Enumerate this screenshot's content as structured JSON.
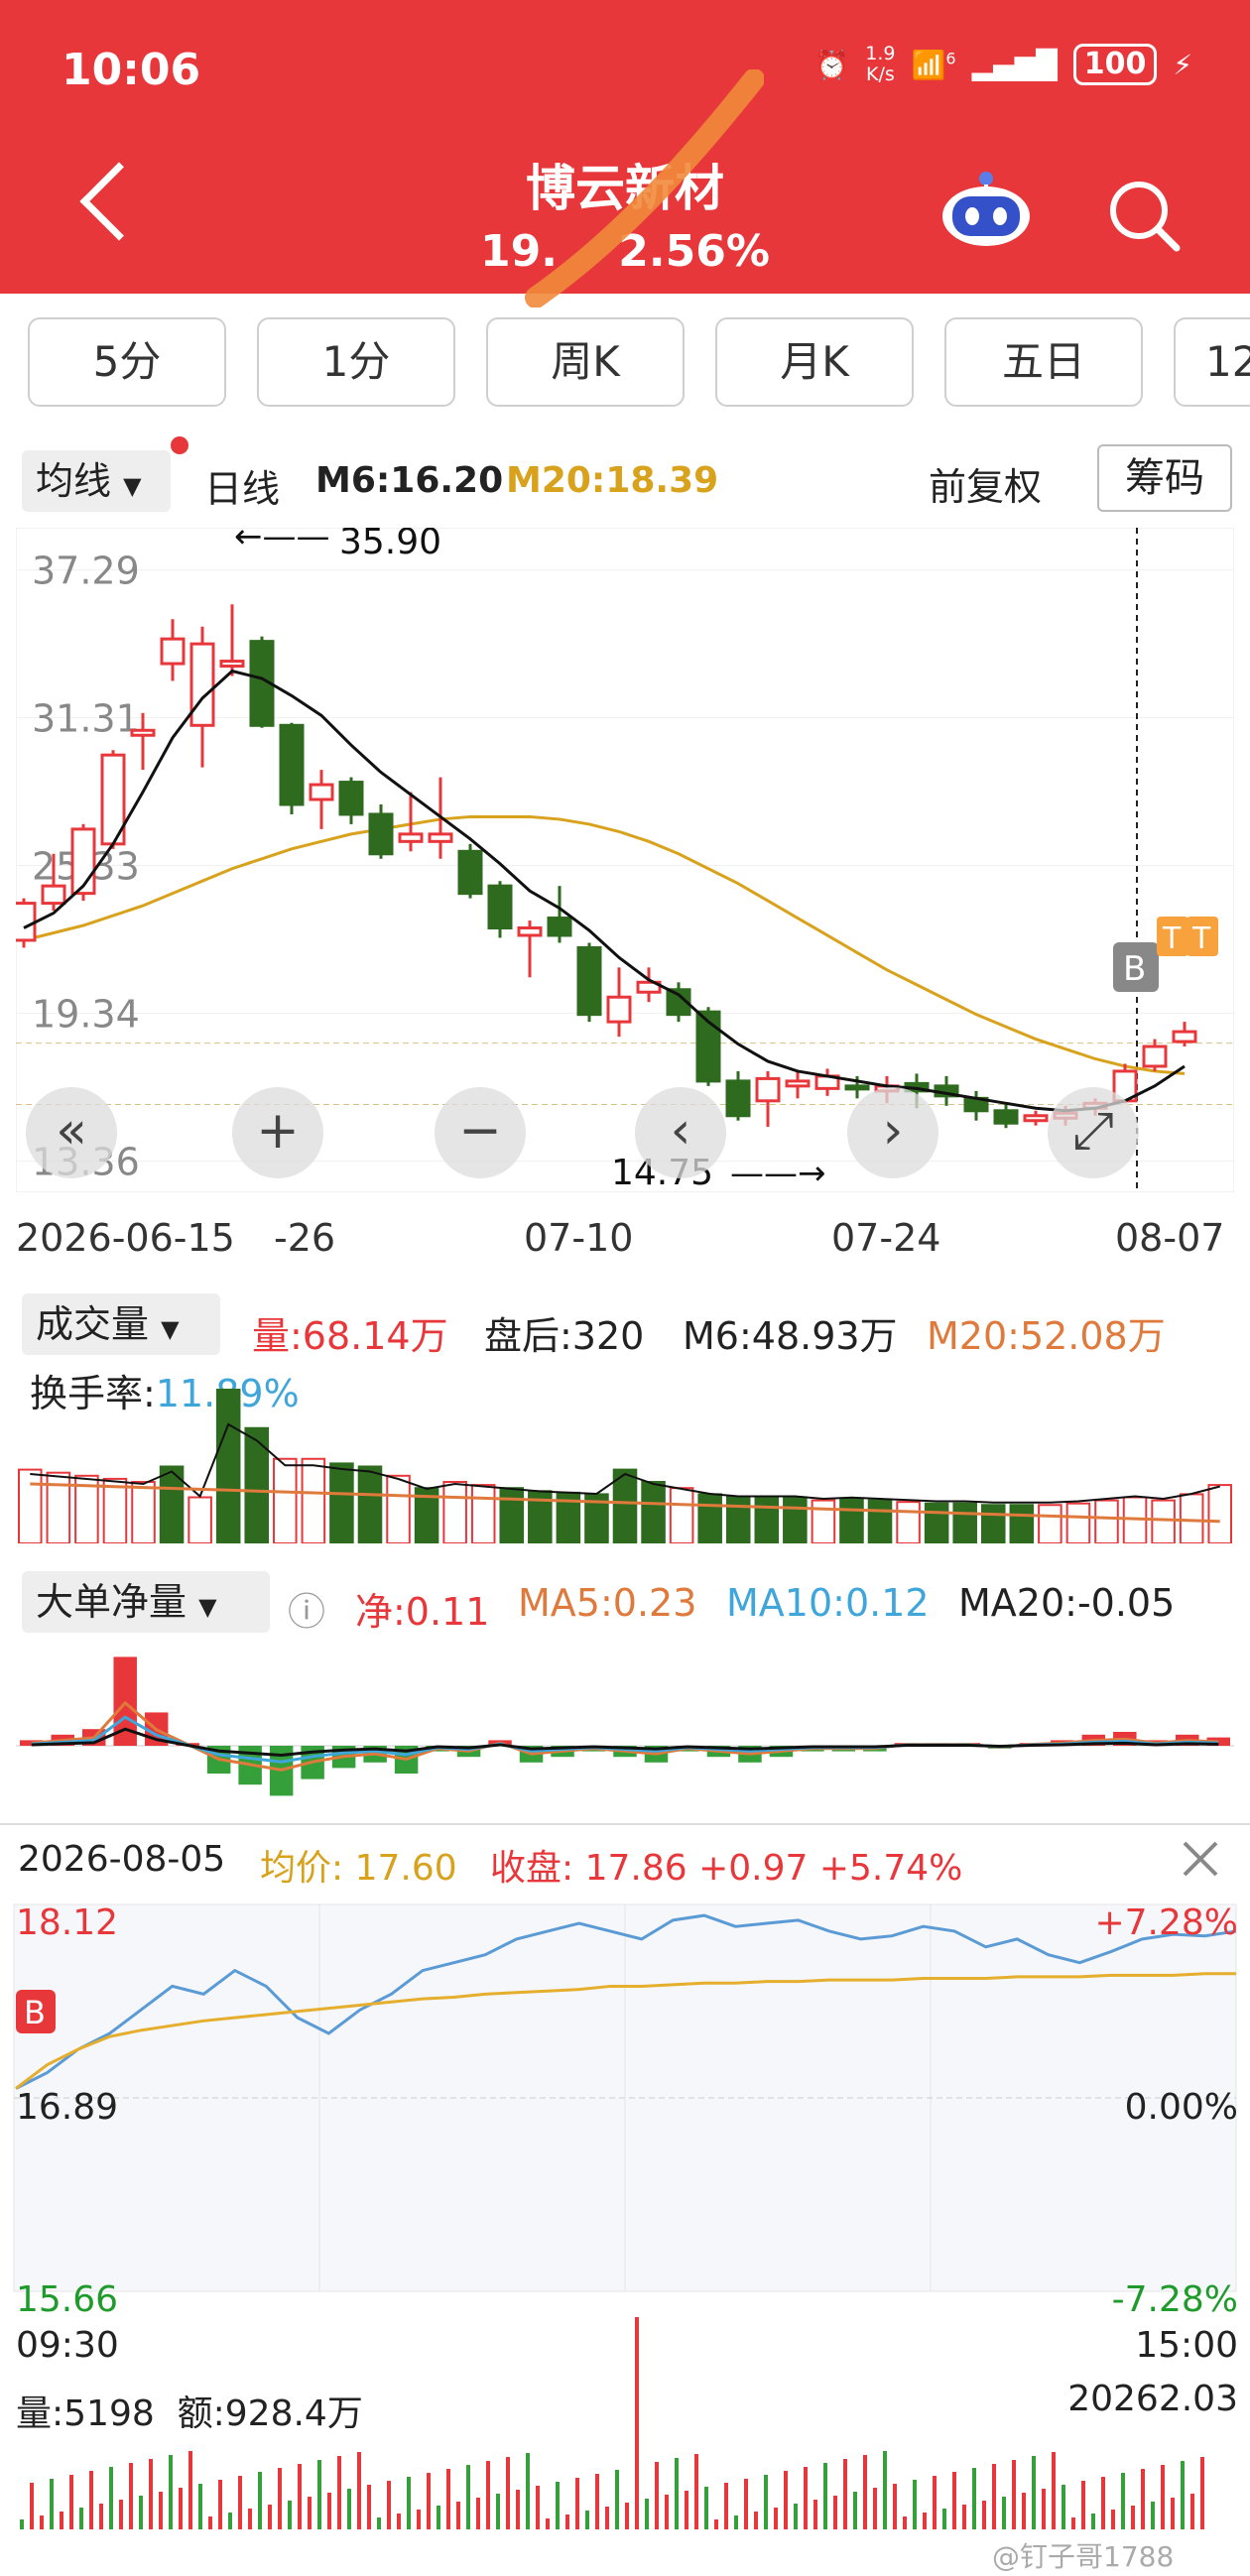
{
  "status_bar": {
    "time": "10:06",
    "net_speed_top": "1.9",
    "net_speed_bottom": "K/s",
    "wifi_badge": "6",
    "battery": "100"
  },
  "header": {
    "stock_name": "博云新材",
    "price_fragment_left": "19.",
    "price_change_pct": "2.56%"
  },
  "tabs": [
    "5分",
    "1分",
    "周K",
    "月K",
    "五日",
    "12"
  ],
  "kline_bar": {
    "indicator": "均线",
    "period": "日线",
    "m6_label": "M6:16.20",
    "m20_label": "M20:18.39",
    "adjust": "前复权",
    "chips": "筹码"
  },
  "kline_chart": {
    "y_ticks": [
      "37.29",
      "31.31",
      "25.33",
      "19.34",
      "13.36"
    ],
    "high_annotation": "35.90",
    "low_annotation": "14.75",
    "badge_b": "B",
    "badge_t": "T",
    "candles": [
      {
        "o": 22.3,
        "c": 23.8,
        "h": 24.0,
        "l": 22.0
      },
      {
        "o": 23.8,
        "c": 24.5,
        "h": 25.8,
        "l": 23.5
      },
      {
        "o": 24.2,
        "c": 26.8,
        "h": 27.0,
        "l": 23.9
      },
      {
        "o": 26.2,
        "c": 29.8,
        "h": 30.0,
        "l": 26.0
      },
      {
        "o": 30.6,
        "c": 30.8,
        "h": 31.5,
        "l": 29.2
      },
      {
        "o": 33.5,
        "c": 34.5,
        "h": 35.3,
        "l": 32.8
      },
      {
        "o": 31.0,
        "c": 34.3,
        "h": 35.0,
        "l": 29.3
      },
      {
        "o": 33.4,
        "c": 33.6,
        "h": 35.9,
        "l": 33.0
      },
      {
        "o": 34.4,
        "c": 31.0,
        "h": 34.6,
        "l": 30.9
      },
      {
        "o": 31.0,
        "c": 27.8,
        "h": 31.1,
        "l": 27.4
      },
      {
        "o": 28.0,
        "c": 28.6,
        "h": 29.2,
        "l": 26.8
      },
      {
        "o": 28.7,
        "c": 27.4,
        "h": 28.9,
        "l": 27.0
      },
      {
        "o": 27.4,
        "c": 25.8,
        "h": 27.8,
        "l": 25.6
      },
      {
        "o": 26.3,
        "c": 26.6,
        "h": 28.3,
        "l": 25.9
      },
      {
        "o": 26.3,
        "c": 26.6,
        "h": 28.9,
        "l": 25.6
      },
      {
        "o": 25.9,
        "c": 24.2,
        "h": 26.2,
        "l": 24.0
      },
      {
        "o": 24.5,
        "c": 22.8,
        "h": 24.7,
        "l": 22.4
      },
      {
        "o": 22.5,
        "c": 22.8,
        "h": 23.1,
        "l": 20.8
      },
      {
        "o": 23.2,
        "c": 22.5,
        "h": 24.5,
        "l": 22.2
      },
      {
        "o": 22.0,
        "c": 19.3,
        "h": 22.2,
        "l": 19.0
      },
      {
        "o": 19.0,
        "c": 20.0,
        "h": 21.2,
        "l": 18.4
      },
      {
        "o": 20.2,
        "c": 20.6,
        "h": 21.2,
        "l": 19.8
      },
      {
        "o": 20.3,
        "c": 19.3,
        "h": 20.6,
        "l": 19.0
      },
      {
        "o": 19.4,
        "c": 16.6,
        "h": 19.6,
        "l": 16.4
      },
      {
        "o": 16.6,
        "c": 15.2,
        "h": 17.0,
        "l": 15.0
      },
      {
        "o": 15.8,
        "c": 16.7,
        "h": 17.0,
        "l": 14.75
      },
      {
        "o": 16.4,
        "c": 16.6,
        "h": 17.0,
        "l": 15.9
      },
      {
        "o": 16.3,
        "c": 16.8,
        "h": 17.1,
        "l": 16.0
      },
      {
        "o": 16.4,
        "c": 16.3,
        "h": 16.8,
        "l": 15.9
      },
      {
        "o": 16.2,
        "c": 16.4,
        "h": 16.8,
        "l": 15.7
      },
      {
        "o": 16.5,
        "c": 16.2,
        "h": 16.9,
        "l": 15.5
      },
      {
        "o": 16.4,
        "c": 16.0,
        "h": 16.8,
        "l": 15.6
      },
      {
        "o": 15.9,
        "c": 15.4,
        "h": 16.2,
        "l": 15.0
      },
      {
        "o": 15.4,
        "c": 14.9,
        "h": 15.7,
        "l": 14.7
      },
      {
        "o": 15.0,
        "c": 15.2,
        "h": 15.4,
        "l": 14.8
      },
      {
        "o": 15.1,
        "c": 15.3,
        "h": 15.6,
        "l": 14.8
      },
      {
        "o": 15.5,
        "c": 15.7,
        "h": 15.9,
        "l": 15.2
      },
      {
        "o": 15.8,
        "c": 17.0,
        "h": 17.3,
        "l": 15.7
      },
      {
        "o": 17.2,
        "c": 18.0,
        "h": 18.3,
        "l": 17.0
      },
      {
        "o": 18.2,
        "c": 18.6,
        "h": 19.0,
        "l": 18.0
      }
    ],
    "m6": [
      22.8,
      23.4,
      24.5,
      26.2,
      28.3,
      30.5,
      32.1,
      33.2,
      32.9,
      32.2,
      31.4,
      30.2,
      29.1,
      28.2,
      27.3,
      26.4,
      25.4,
      24.3,
      23.6,
      22.7,
      21.6,
      20.7,
      20.1,
      19.0,
      18.1,
      17.4,
      17.0,
      16.8,
      16.6,
      16.4,
      16.3,
      16.1,
      15.9,
      15.7,
      15.5,
      15.4,
      15.5,
      15.8,
      16.4,
      17.2
    ],
    "m20": [
      22.3,
      22.6,
      22.9,
      23.3,
      23.7,
      24.2,
      24.7,
      25.2,
      25.6,
      26.0,
      26.3,
      26.6,
      26.8,
      27.0,
      27.2,
      27.3,
      27.3,
      27.3,
      27.2,
      27.0,
      26.7,
      26.3,
      25.8,
      25.2,
      24.6,
      23.9,
      23.2,
      22.5,
      21.8,
      21.1,
      20.5,
      19.9,
      19.3,
      18.8,
      18.3,
      17.9,
      17.5,
      17.2,
      17.0,
      16.9
    ],
    "dates": [
      "2026-06-15",
      "-26",
      "07-10",
      "07-24",
      "08-07"
    ]
  },
  "volume": {
    "indicator": "成交量",
    "vol_label": "量:68.14万",
    "after_label": "盘后:320",
    "m6_label": "M6:48.93万",
    "m20_label": "M20:52.08万",
    "turnover_label": "换手率:",
    "turnover_value": "11.89%",
    "bars": [
      48,
      46,
      44,
      42,
      40,
      50,
      30,
      100,
      75,
      55,
      55,
      52,
      50,
      44,
      36,
      40,
      38,
      36,
      34,
      33,
      32,
      48,
      40,
      36,
      32,
      30,
      30,
      30,
      28,
      29,
      28,
      27,
      26,
      26,
      25,
      25,
      25,
      26,
      28,
      30,
      28,
      32,
      38
    ]
  },
  "bigorder": {
    "indicator": "大单净量",
    "net_label": "净:0.11",
    "ma5_label": "MA5:0.23",
    "ma10_label": "MA10:0.12",
    "ma20_label": "MA20:-0.05",
    "bars": [
      0.1,
      0.2,
      0.3,
      1.6,
      0.6,
      0.05,
      -0.5,
      -0.7,
      -0.9,
      -0.6,
      -0.4,
      -0.3,
      -0.5,
      -0.1,
      -0.2,
      0.1,
      -0.3,
      -0.2,
      -0.1,
      -0.2,
      -0.3,
      -0.1,
      -0.2,
      -0.3,
      -0.2,
      -0.1,
      -0.1,
      -0.1,
      0.05,
      0.05,
      0.05,
      -0.05,
      0.05,
      0.1,
      0.2,
      0.25,
      0.1,
      0.2,
      0.15
    ]
  },
  "intraday": {
    "date": "2026-08-05",
    "avg_label": "均价: 17.60",
    "close_label": "收盘: 17.86 +0.97 +5.74%",
    "y_top": "18.12",
    "y_mid": "16.89",
    "y_bottom": "15.66",
    "pct_top": "+7.28%",
    "pct_mid": "0.00%",
    "pct_bottom": "-7.28%",
    "t_start": "09:30",
    "t_end": "15:00",
    "badge": "B",
    "vol_label": "量:5198",
    "amount_label": "额:928.4万",
    "cum_label": "20262.03",
    "price": [
      16.95,
      17.05,
      17.2,
      17.3,
      17.45,
      17.6,
      17.55,
      17.7,
      17.6,
      17.4,
      17.3,
      17.45,
      17.55,
      17.7,
      17.75,
      17.8,
      17.9,
      17.95,
      18.0,
      17.95,
      17.9,
      18.02,
      18.05,
      17.98,
      18.0,
      18.02,
      17.95,
      17.9,
      17.92,
      17.98,
      17.95,
      17.85,
      17.9,
      17.8,
      17.75,
      17.82,
      17.9,
      17.93,
      17.92,
      17.95
    ],
    "avg": [
      16.95,
      17.1,
      17.2,
      17.28,
      17.32,
      17.35,
      17.38,
      17.4,
      17.42,
      17.44,
      17.46,
      17.48,
      17.5,
      17.52,
      17.53,
      17.55,
      17.56,
      17.57,
      17.58,
      17.6,
      17.6,
      17.61,
      17.62,
      17.62,
      17.63,
      17.63,
      17.64,
      17.64,
      17.64,
      17.65,
      17.65,
      17.65,
      17.66,
      17.66,
      17.66,
      17.67,
      17.67,
      17.67,
      17.68,
      17.68
    ]
  },
  "watermark": "@钉子哥1788"
}
